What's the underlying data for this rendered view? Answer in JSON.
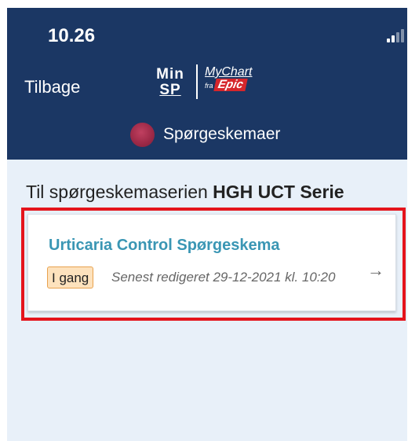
{
  "status_bar": {
    "time": "10.26"
  },
  "header": {
    "back_label": "Tilbage",
    "logo_minsp": {
      "line1": "Min",
      "line2": "SP"
    },
    "logo_mychart": {
      "name": "MyChart",
      "fra": "fra",
      "brand": "Epic"
    },
    "section_title": "Spørgeskemaer"
  },
  "main": {
    "heading_prefix": "Til spørgeskemaserien ",
    "heading_series": "HGH UCT Serie",
    "cards": [
      {
        "title": "Urticaria Control Spørgeskema",
        "status": "I gang",
        "edited": "Senest redigeret 29-12-2021 kl. 10:20"
      }
    ]
  },
  "colors": {
    "header_bg": "#1b3764",
    "page_bg": "#e8f0f9",
    "card_title": "#3a96b4",
    "badge_bg": "#fde2bd",
    "badge_border": "#e8a24e",
    "highlight": "#e4141c"
  },
  "icons": [
    "signal-icon",
    "wifi-icon",
    "battery-icon",
    "avatar",
    "arrow-right-icon"
  ]
}
